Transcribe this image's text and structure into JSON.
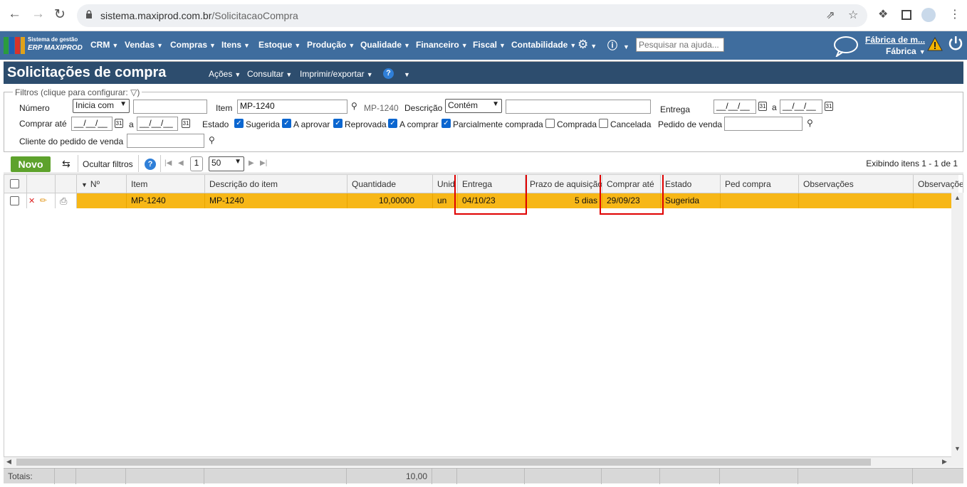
{
  "browser": {
    "url_domain": "sistema.maxiprod.com.br",
    "url_path": "/SolicitacaoCompra"
  },
  "app": {
    "brand_line1": "Sistema de gestão",
    "brand_line2": "ERP MAXIPROD",
    "menu": [
      "CRM",
      "Vendas",
      "Compras",
      "Itens",
      "Estoque",
      "Produção",
      "Qualidade",
      "Financeiro",
      "Fiscal",
      "Contabilidade"
    ],
    "help_search_placeholder": "Pesquisar na ajuda...",
    "company_name": "Fábrica de m...",
    "company_unit": "Fábrica",
    "accent_color": "#3f6d9e"
  },
  "page": {
    "title": "Solicitações de compra",
    "actions": [
      "Ações",
      "Consultar",
      "Imprimir/exportar"
    ]
  },
  "filters": {
    "legend": "Filtros (clique para configurar:",
    "numero_label": "Número",
    "numero_mode": "Inicia com",
    "numero_value": "",
    "item_label": "Item",
    "item_value": "MP-1240",
    "item_code": "MP-1240",
    "descricao_label": "Descrição",
    "descricao_mode": "Contém",
    "descricao_value": "",
    "entrega_label": "Entrega",
    "date_placeholder": "__/__/__",
    "a": "a",
    "comprar_ate_label": "Comprar até",
    "estado_label": "Estado",
    "estados": [
      {
        "label": "Sugerida",
        "checked": true
      },
      {
        "label": "A aprovar",
        "checked": true
      },
      {
        "label": "Reprovada",
        "checked": true
      },
      {
        "label": "A comprar",
        "checked": true
      },
      {
        "label": "Parcialmente comprada",
        "checked": true
      },
      {
        "label": "Comprada",
        "checked": false
      },
      {
        "label": "Cancelada",
        "checked": false
      }
    ],
    "pedido_venda_label": "Pedido de venda",
    "cliente_label": "Cliente do pedido de venda"
  },
  "toolbar": {
    "novo": "Novo",
    "ocultar_filtros": "Ocultar filtros",
    "page": "1",
    "page_size": "50",
    "showing": "Exibindo itens 1 - 1 de 1"
  },
  "grid": {
    "columns": [
      "Nº",
      "Item",
      "Descrição do item",
      "Quantidade",
      "Unid",
      "Entrega",
      "Prazo de aquisição",
      "Comprar até",
      "Estado",
      "Ped compra",
      "Observações",
      "Observações"
    ],
    "rows": [
      {
        "numero": "",
        "item": "MP-1240",
        "descricao": "MP-1240",
        "quantidade": "10,00000",
        "unid": "un",
        "entrega": "04/10/23",
        "prazo": "5 dias",
        "comprar_ate": "29/09/23",
        "estado": "Sugerida",
        "ped_compra": "",
        "observacoes": "",
        "observacoes2": ""
      }
    ],
    "totals_label": "Totais:",
    "totals_quantidade": "10,00",
    "highlight_color": "#f7b717"
  }
}
